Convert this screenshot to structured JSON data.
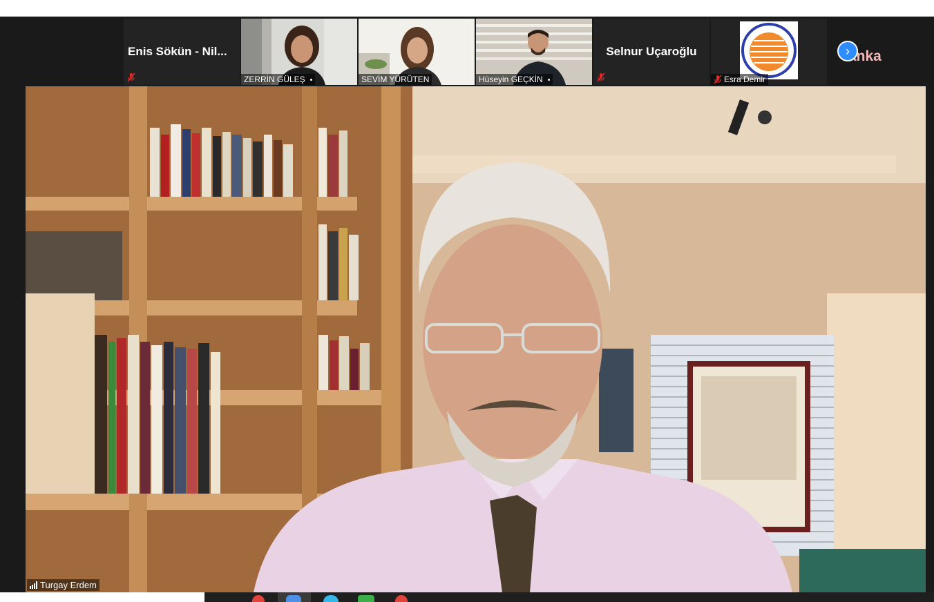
{
  "participants": [
    {
      "name": "Enis Sökün - Nil...",
      "muted": true,
      "video": false
    },
    {
      "name": "ZERRİN GÜLEŞ",
      "muted": false,
      "video": true
    },
    {
      "name": "SEVİM YÜRÜTEN",
      "muted": false,
      "video": true
    },
    {
      "name": "Hüseyin GEÇKİN",
      "muted": false,
      "video": true
    },
    {
      "name": "Selnur Uçaroğlu",
      "muted": true,
      "video": false
    },
    {
      "name": "Esra Demir",
      "muted": true,
      "video": true
    }
  ],
  "overflow": {
    "label": "anka",
    "icon": "chevron-right-icon"
  },
  "active_speaker": {
    "name": "Turgay Erdem",
    "icon": "signal-bars-icon"
  },
  "colors": {
    "background": "#1a1a1a",
    "accent": "#2d8cff",
    "muted_red": "#e02828"
  }
}
